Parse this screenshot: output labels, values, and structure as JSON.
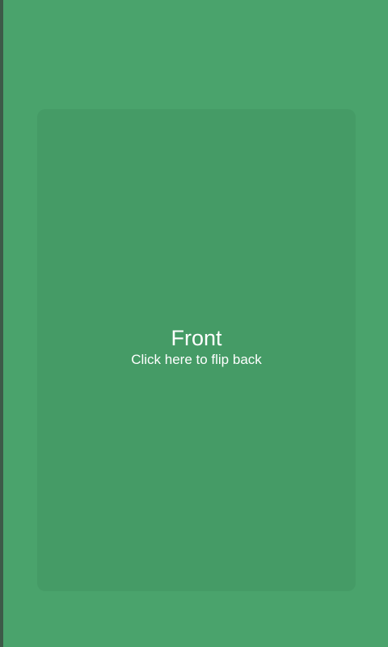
{
  "card": {
    "title": "Front",
    "subtitle": "Click here to flip back"
  },
  "colors": {
    "background": "#4aa36c",
    "card": "#459b66",
    "text": "#ffffff"
  }
}
